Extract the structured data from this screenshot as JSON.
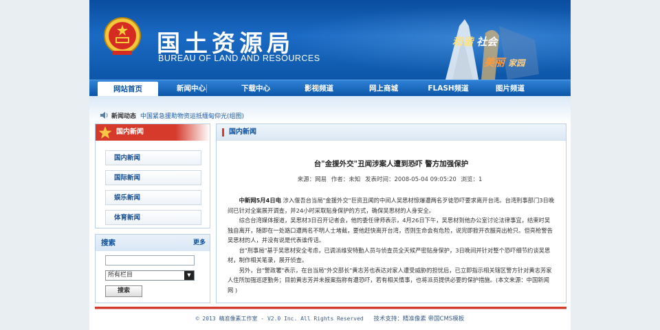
{
  "header": {
    "title_cn": "国土资源局",
    "title_en": "BUREAU OF LAND AND RESOURCES",
    "slogan_part1": "和谐",
    "slogan_part2": "社会",
    "slogan_part3": "美丽",
    "slogan_part4": "家园"
  },
  "nav": {
    "items": [
      {
        "label": "网站首页",
        "active": true
      },
      {
        "label": "新闻中心",
        "active": false
      },
      {
        "label": "下载中心",
        "active": false
      },
      {
        "label": "影视频道",
        "active": false
      },
      {
        "label": "网上商城",
        "active": false
      },
      {
        "label": "FLASH频道",
        "active": false
      },
      {
        "label": "图片频道",
        "active": false
      }
    ]
  },
  "ticker": {
    "label": "新闻动态",
    "text": "中国紧急援助物资运抵缅甸仰光(组图)"
  },
  "sidebar": {
    "news_title": "国内新闻",
    "links": [
      "国内新闻",
      "国际新闻",
      "娱乐新闻",
      "体育新闻"
    ],
    "search_title": "搜索",
    "more_label": "更多",
    "search_value": "",
    "select_value": "所有栏目",
    "search_button": "搜索"
  },
  "article": {
    "section": "国内新闻",
    "title": "台\"金援外交\"丑闻涉案人遭到恐吓 警方加强保护",
    "source": "来源：网易",
    "author": "作者：未知",
    "time": "发表时间：2008-05-04 09:05:20",
    "views": "浏览：1",
    "lead": "中新网5月4日电",
    "p1": "涉入偃吾台当局\"金援外交\"巨资丑闻的中间人吴思材惊爆遭两名歹徒恐吓要求离开台湾。台湾刑事部门3日晚间已针对全案展开调查，并24小时采取贴身保护的方式，确保吴思材的人身安全。",
    "p2": "综合台湾媒体报道，吴思材3日召开记者会，他的委任律师表示，4月26日下午，吴思材到他办公室讨论法律事宜，结束时吴独自离开，随即在一处路口遭两名不明人士堵截，要他赶快离开台湾，否则生命会有危险，说完即掀开衣服亮出枪只。但亮枪警告吴思材的人，并没有说是代表谁传话。",
    "p3": "台\"刑事局\"基于吴思材安全考虑，已调派维安特勤人员与侦查员全天候严密贴身保护，3日晚间并针对整个恐吓细节约谈吴思材，制作相关笔录，展开侦查。",
    "p4": "另外，台\"警政署\"表示，在台当局\"外交部长\"黄志芳也表达对家人遭受威胁的担忧后，已立即指示相关辖区警方针对黄志芳家人住所加强巡逻勤务；目前黄志芳并未报案指称有遭恐吓，若有相关情事，也将派员提供必要的保护措施。(本文来源：中国新闻网 )"
  },
  "footer": {
    "copyright": "© 2013 精准像素工作室 - V2.0 Inc. All Rights Reserved",
    "support": "技术支持：精准像素 帝国CMS模板"
  },
  "colors": {
    "header_blue": "#0d56a8",
    "accent_red": "#d63a2b",
    "link_blue": "#1a5aa6"
  }
}
